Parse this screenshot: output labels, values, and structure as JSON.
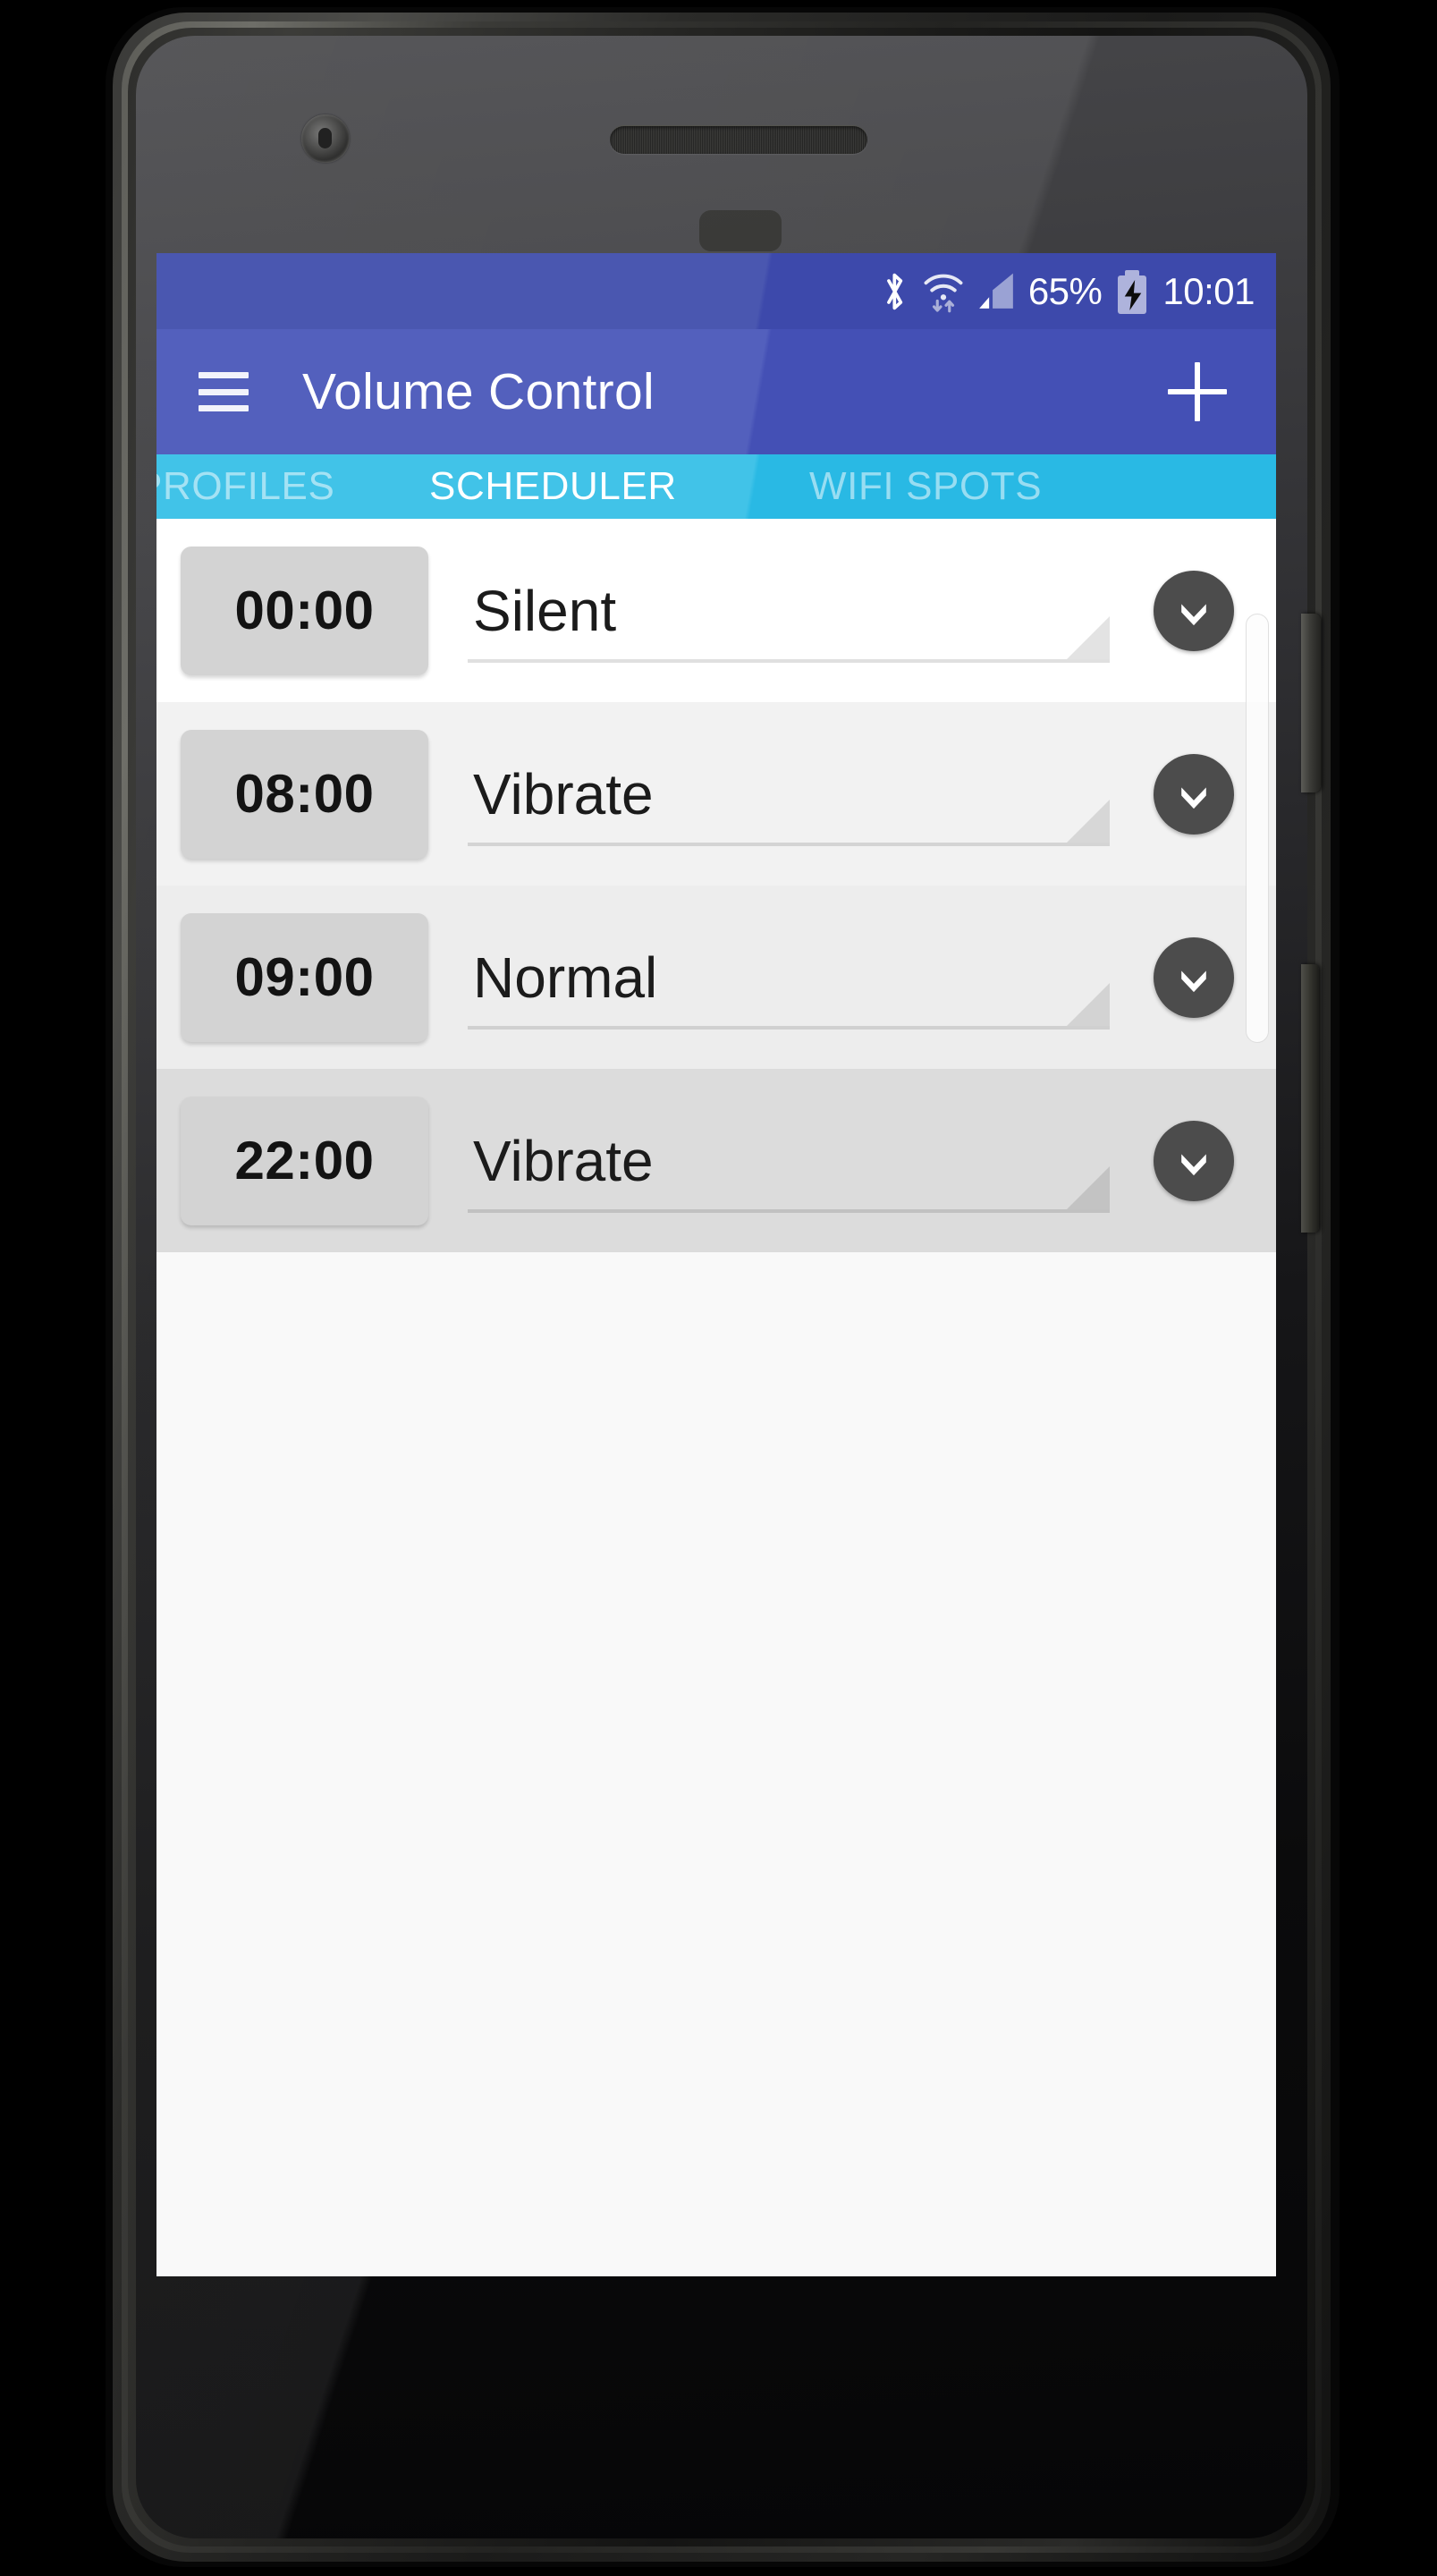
{
  "status_bar": {
    "bluetooth_icon": "bluetooth-icon",
    "wifi_icon": "wifi-icon",
    "signal_icon": "cellular-signal-icon",
    "battery_percent": "65%",
    "battery_icon": "battery-charging-icon",
    "clock": "10:01"
  },
  "app_bar": {
    "menu_icon": "hamburger-menu-icon",
    "title": "Volume Control",
    "add_icon": "plus-icon"
  },
  "tabs": [
    {
      "label": "PROFILES",
      "active": false
    },
    {
      "label": "SCHEDULER",
      "active": true
    },
    {
      "label": "WIFI SPOTS",
      "active": false
    }
  ],
  "schedule_rows": [
    {
      "time": "00:00",
      "profile": "Silent",
      "expand_icon": "chevron-down-icon"
    },
    {
      "time": "08:00",
      "profile": "Vibrate",
      "expand_icon": "chevron-down-icon"
    },
    {
      "time": "09:00",
      "profile": "Normal",
      "expand_icon": "chevron-down-icon"
    },
    {
      "time": "22:00",
      "profile": "Vibrate",
      "expand_icon": "chevron-down-icon"
    }
  ],
  "colors": {
    "status_bar": "#4a57b0",
    "app_bar": "#5360bd",
    "tab_bar": "#29b9e4",
    "chip": "#d3d3d3",
    "chevron_button": "#4c4c4c",
    "screen_background": "#f9f9f9"
  }
}
